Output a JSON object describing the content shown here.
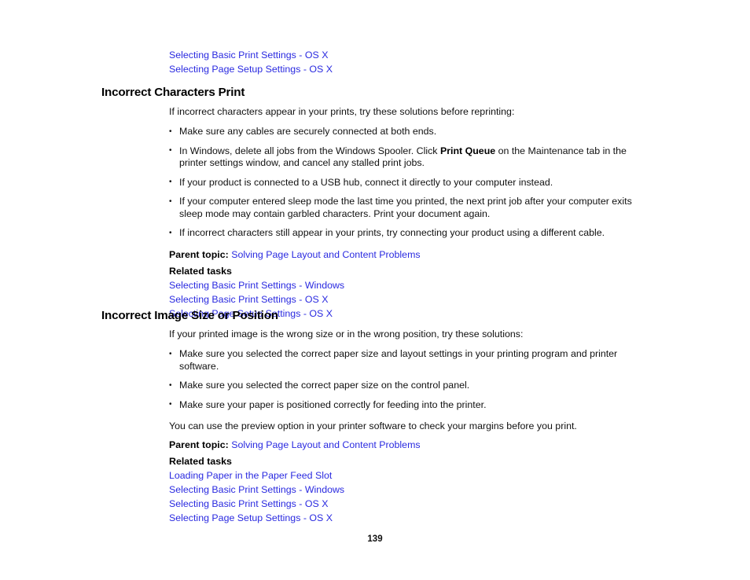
{
  "document": {
    "page_number": "139",
    "link_color": "#2a2ae0",
    "text_color": "#111111"
  },
  "top_links": [
    "Selecting Basic Print Settings - OS X",
    "Selecting Page Setup Settings - OS X"
  ],
  "sections": [
    {
      "heading": "Incorrect Characters Print",
      "intro": "If incorrect characters appear in your prints, try these solutions before reprinting:",
      "bullets": [
        {
          "pre": "Make sure any cables are securely connected at both ends.",
          "bold": "",
          "post": ""
        },
        {
          "pre": "In Windows, delete all jobs from the Windows Spooler. Click ",
          "bold": "Print Queue",
          "post": " on the Maintenance tab in the printer settings window, and cancel any stalled print jobs."
        },
        {
          "pre": "If your product is connected to a USB hub, connect it directly to your computer instead.",
          "bold": "",
          "post": ""
        },
        {
          "pre": "If your computer entered sleep mode the last time you printed, the next print job after your computer exits sleep mode may contain garbled characters. Print your document again.",
          "bold": "",
          "post": ""
        },
        {
          "pre": "If incorrect characters still appear in your prints, try connecting your product using a different cable.",
          "bold": "",
          "post": ""
        }
      ],
      "closing": "",
      "parent_topic_label": "Parent topic:",
      "parent_topic_link": "Solving Page Layout and Content Problems",
      "related_tasks_label": "Related tasks",
      "related_tasks": [
        "Selecting Basic Print Settings - Windows",
        "Selecting Basic Print Settings - OS X",
        "Selecting Page Setup Settings - OS X"
      ]
    },
    {
      "heading": "Incorrect Image Size or Position",
      "intro": "If your printed image is the wrong size or in the wrong position, try these solutions:",
      "bullets": [
        {
          "pre": "Make sure you selected the correct paper size and layout settings in your printing program and printer software.",
          "bold": "",
          "post": ""
        },
        {
          "pre": "Make sure you selected the correct paper size on the control panel.",
          "bold": "",
          "post": ""
        },
        {
          "pre": "Make sure your paper is positioned correctly for feeding into the printer.",
          "bold": "",
          "post": ""
        }
      ],
      "closing": "You can use the preview option in your printer software to check your margins before you print.",
      "parent_topic_label": "Parent topic:",
      "parent_topic_link": "Solving Page Layout and Content Problems",
      "related_tasks_label": "Related tasks",
      "related_tasks": [
        "Loading Paper in the Paper Feed Slot",
        "Selecting Basic Print Settings - Windows",
        "Selecting Basic Print Settings - OS X",
        "Selecting Page Setup Settings - OS X"
      ]
    }
  ]
}
